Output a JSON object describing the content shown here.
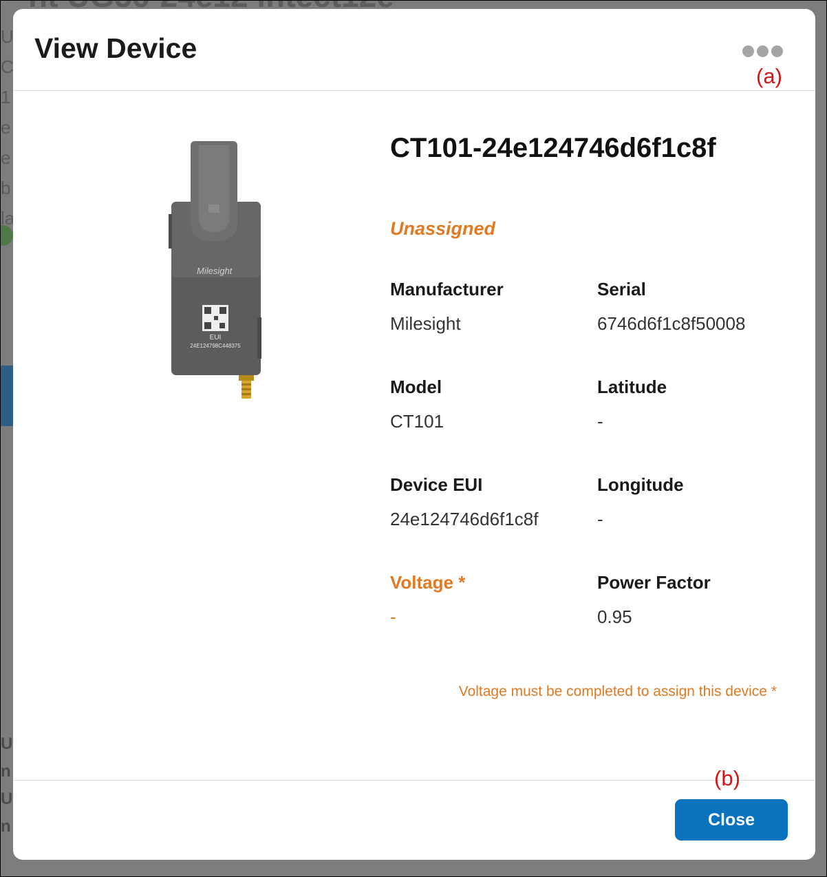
{
  "background": {
    "title_fragment": "nt UG56-24e12 intect12e",
    "side_letters": [
      "U",
      "C",
      "1",
      "e",
      "e",
      "b",
      "la"
    ],
    "bottom_letters": [
      "U",
      "n",
      "U",
      "n"
    ]
  },
  "modal": {
    "title": "View Device",
    "annotation_a": "(a)",
    "annotation_b": "(b)",
    "device": {
      "name": "CT101-24e124746d6f1c8f",
      "status": "Unassigned",
      "image_brand": "Milesight",
      "image_eui_label": "EUI",
      "image_eui_value": "24E124798C448375"
    },
    "fields": {
      "manufacturer": {
        "label": "Manufacturer",
        "value": "Milesight"
      },
      "serial": {
        "label": "Serial",
        "value": "6746d6f1c8f50008"
      },
      "model": {
        "label": "Model",
        "value": "CT101"
      },
      "latitude": {
        "label": "Latitude",
        "value": "-"
      },
      "device_eui": {
        "label": "Device EUI",
        "value": "24e124746d6f1c8f"
      },
      "longitude": {
        "label": "Longitude",
        "value": "-"
      },
      "voltage": {
        "label": "Voltage *",
        "value": "-"
      },
      "power_factor": {
        "label": "Power Factor",
        "value": "0.95"
      }
    },
    "note": "Voltage must be completed to assign this device *",
    "close_label": "Close"
  },
  "colors": {
    "accent": "#0a73bd",
    "warning": "#e07a23",
    "annotation": "#d81313",
    "more_dots": "#a5a5a5"
  },
  "icons": {
    "more": "more-horizontal-icon"
  }
}
